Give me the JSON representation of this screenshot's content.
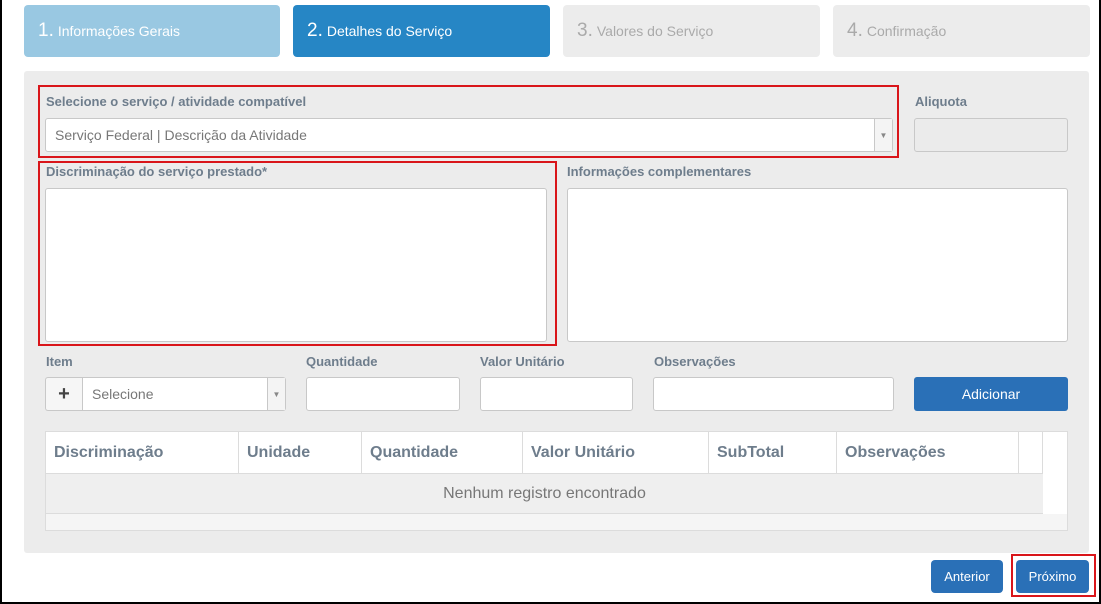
{
  "steps": [
    {
      "num": "1.",
      "label": "Informações Gerais"
    },
    {
      "num": "2.",
      "label": "Detalhes do Serviço"
    },
    {
      "num": "3.",
      "label": "Valores do Serviço"
    },
    {
      "num": "4.",
      "label": "Confirmação"
    }
  ],
  "form": {
    "service_label": "Selecione o serviço / atividade compatível",
    "service_value": "Serviço Federal | Descrição da Atividade",
    "aliquota_label": "Aliquota",
    "aliquota_value": "",
    "discriminacao_label": "Discriminação do serviço prestado*",
    "discriminacao_value": "",
    "complementares_label": "Informações complementares",
    "complementares_value": ""
  },
  "item_row": {
    "item_label": "Item",
    "item_placeholder": "Selecione",
    "quantidade_label": "Quantidade",
    "valor_label": "Valor Unitário",
    "obs_label": "Observações",
    "add_button": "Adicionar",
    "plus_icon": "+"
  },
  "table": {
    "columns": [
      "Discriminação",
      "Unidade",
      "Quantidade",
      "Valor Unitário",
      "SubTotal",
      "Observações"
    ],
    "empty_message": "Nenhum registro encontrado"
  },
  "nav": {
    "prev": "Anterior",
    "next": "Próximo"
  },
  "colors": {
    "accent": "#2686c5",
    "button": "#2a70b7",
    "highlight": "#d9151a"
  }
}
